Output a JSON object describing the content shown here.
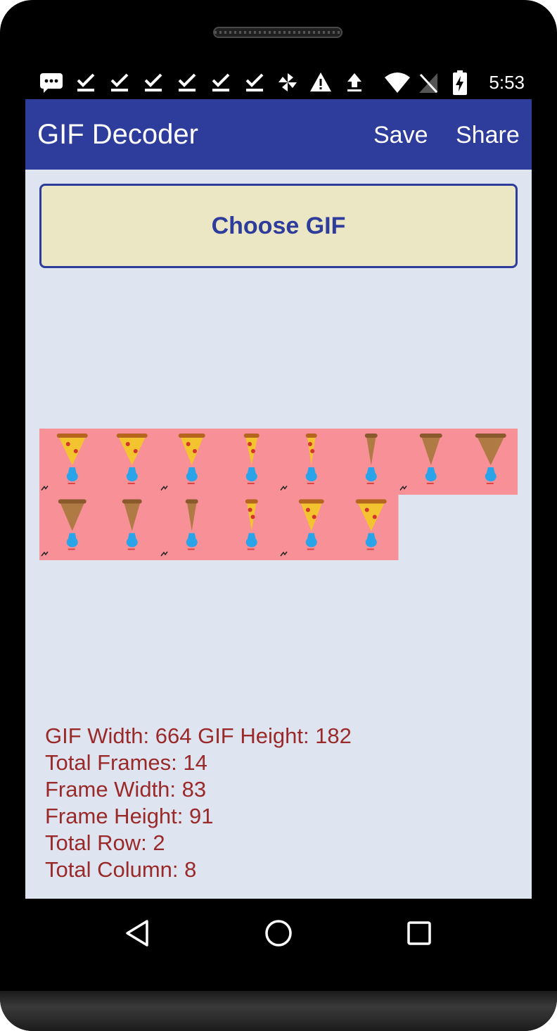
{
  "status_bar": {
    "time": "5:53",
    "icons": [
      "message-icon",
      "check-icon",
      "check-icon",
      "check-icon",
      "check-icon",
      "check-icon",
      "check-icon",
      "pinwheel-icon",
      "warning-icon",
      "upload-icon",
      "wifi-icon",
      "no-signal-icon",
      "battery-charging-icon"
    ]
  },
  "appbar": {
    "title": "GIF Decoder",
    "save_label": "Save",
    "share_label": "Share",
    "color": "#2e3c9c"
  },
  "choose_button": {
    "label": "Choose GIF"
  },
  "sprite_sheet": {
    "background": "#f89097",
    "columns": 8,
    "rows": 2,
    "frames": 14
  },
  "info": {
    "line1": "GIF Width: 664 GIF Height: 182",
    "line2": "Total Frames: 14",
    "line3": "Frame Width: 83",
    "line4": "Frame Height: 91",
    "line5": "Total Row: 2",
    "line6": "Total Column: 8"
  },
  "nav_bar": {
    "buttons": [
      "back-icon",
      "home-icon",
      "recents-icon"
    ]
  }
}
